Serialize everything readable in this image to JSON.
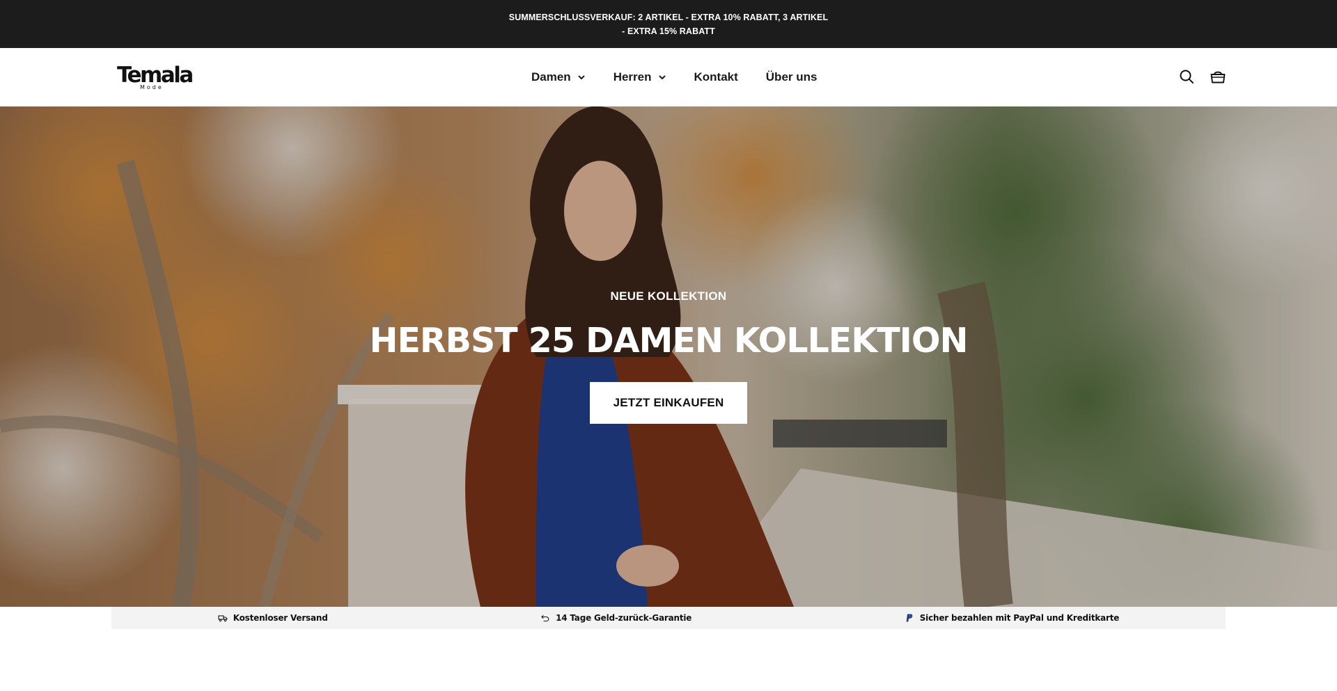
{
  "announcement": {
    "text": "SUMMERSCHLUSSVERKAUF: 2 ARTIKEL - EXTRA 10% RABATT, 3 ARTIKEL - EXTRA 15% RABATT"
  },
  "header": {
    "logo_text": "Temala",
    "logo_subtext": "Mode",
    "nav": [
      {
        "label": "Damen",
        "has_dropdown": true
      },
      {
        "label": "Herren",
        "has_dropdown": true
      },
      {
        "label": "Kontakt",
        "has_dropdown": false
      },
      {
        "label": "Über uns",
        "has_dropdown": false
      }
    ],
    "icons": [
      "search-icon",
      "cart-icon"
    ]
  },
  "hero": {
    "eyebrow": "NEUE KOLLEKTION",
    "title": "HERBST 25 DAMEN KOLLEKTION",
    "button_label": "JETZT EINKAUFEN"
  },
  "trust_bar": {
    "items": [
      {
        "icon": "truck-icon",
        "label": "Kostenloser Versand"
      },
      {
        "icon": "return-icon",
        "label": "14 Tage Geld-zurück-Garantie"
      },
      {
        "icon": "paypal-icon",
        "label": "Sicher bezahlen mit PayPal und Kreditkarte"
      }
    ]
  },
  "colors": {
    "announcement_bg": "#1c1c1c",
    "header_bg": "#ffffff",
    "hero_button_bg": "#ffffff",
    "trust_bar_bg": "#f3f3f3",
    "paypal_blue": "#253b80"
  }
}
